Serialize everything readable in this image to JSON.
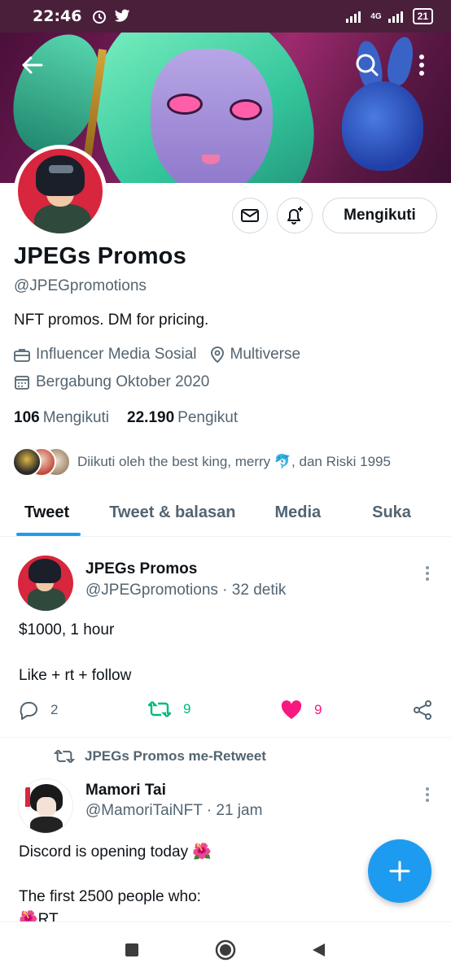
{
  "status_bar": {
    "time": "22:46",
    "network": "4G",
    "battery": "21"
  },
  "profile": {
    "name": "JPEGs Promos",
    "handle": "@JPEGpromotions",
    "bio": "NFT promos. DM for pricing.",
    "category": "Influencer Media Sosial",
    "location": "Multiverse",
    "joined": "Bergabung Oktober 2020",
    "following_count": "106",
    "following_label": "Mengikuti",
    "followers_count": "22.190",
    "followers_label": "Pengikut",
    "followed_by": "Diikuti oleh the best king, merry 🐬, dan Riski 1995",
    "follow_button": "Mengikuti"
  },
  "tabs": [
    {
      "label": "Tweet",
      "active": true
    },
    {
      "label": "Tweet & balasan",
      "active": false
    },
    {
      "label": "Media",
      "active": false
    },
    {
      "label": "Suka",
      "active": false
    }
  ],
  "tweets": [
    {
      "name": "JPEGs Promos",
      "handle_time": "@JPEGpromotions · 32 detik",
      "line1": "$1000, 1 hour",
      "line2": "Like + rt + follow",
      "replies": "2",
      "retweets": "9",
      "likes": "9"
    },
    {
      "retweet_label": "JPEGs Promos me-Retweet",
      "name": "Mamori Tai",
      "handle_time": "@MamoriTaiNFT · 21 jam",
      "line1": "Discord is opening today 🌺",
      "line2": "The first 2500 people who:",
      "line3": "🌺RT"
    }
  ],
  "colors": {
    "accent": "#1d9bf0",
    "retweet": "#00ba7c",
    "like": "#f91880",
    "secondary_text": "#536471"
  },
  "icons": [
    "back-arrow-icon",
    "search-icon",
    "more-vertical-icon",
    "mail-icon",
    "bell-plus-icon",
    "briefcase-icon",
    "location-pin-icon",
    "calendar-icon",
    "reply-icon",
    "retweet-icon",
    "heart-icon",
    "share-icon",
    "compose-plus-icon"
  ]
}
